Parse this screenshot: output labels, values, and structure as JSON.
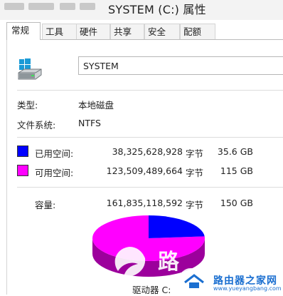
{
  "window": {
    "title": "SYSTEM (C:) 属性"
  },
  "tabs": [
    {
      "label": "常规"
    },
    {
      "label": "工具"
    },
    {
      "label": "硬件"
    },
    {
      "label": "共享"
    },
    {
      "label": "安全"
    },
    {
      "label": "配额"
    }
  ],
  "drive": {
    "name": "SYSTEM",
    "icon": "drive-icon",
    "type_label": "类型:",
    "type_value": "本地磁盘",
    "fs_label": "文件系统:",
    "fs_value": "NTFS"
  },
  "usage": {
    "used": {
      "label": "已用空间:",
      "bytes": "38,325,628,928",
      "unit": "字节",
      "size": "35.6 GB",
      "color": "#0000ff"
    },
    "free": {
      "label": "可用空间:",
      "bytes": "123,509,489,664",
      "unit": "字节",
      "size": "115 GB",
      "color": "#ff00ff"
    },
    "capacity": {
      "label": "容量:",
      "bytes": "161,835,118,592",
      "unit": "字节",
      "size": "150 GB"
    }
  },
  "chart": {
    "used_fraction": 0.2368,
    "drive_label": "驱动器 C:"
  },
  "watermark": {
    "road": "路",
    "site_text": "路由器之家网",
    "url": "www.yueyangbang.com"
  }
}
